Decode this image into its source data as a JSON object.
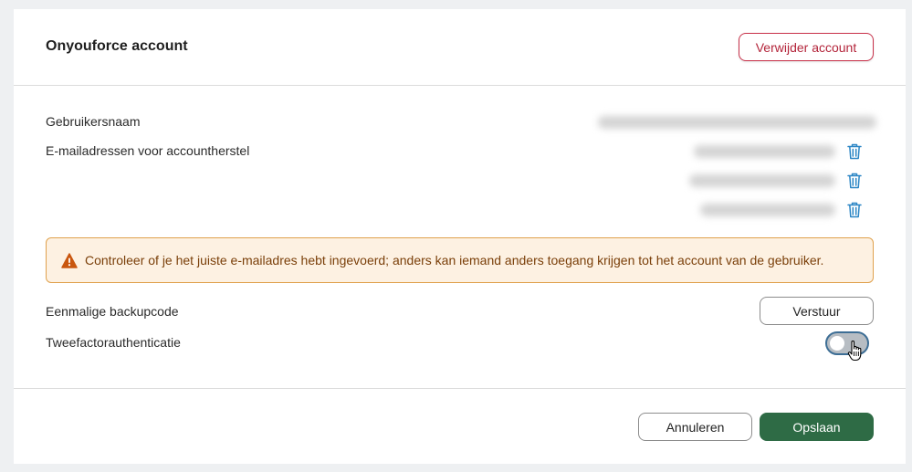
{
  "header": {
    "title": "Onyouforce account",
    "delete_label": "Verwijder account"
  },
  "fields": {
    "username_label": "Gebruikersnaam",
    "recovery_label": "E-mailadressen voor accountherstel",
    "backup_label": "Eenmalige backupcode",
    "twofactor_label": "Tweefactorauthenticatie"
  },
  "alert": {
    "text": "Controleer of je het juiste e-mailadres hebt ingevoerd; anders kan iemand anders toegang krijgen tot het account van de gebruiker."
  },
  "buttons": {
    "send_label": "Verstuur",
    "cancel_label": "Annuleren",
    "save_label": "Opslaan"
  },
  "toggle": {
    "twofactor_enabled": false
  },
  "icons": {
    "alert": "warning-icon",
    "trash": "trash-icon",
    "cursor": "hand-pointer-icon"
  },
  "colors": {
    "danger": "#c8314a",
    "primary": "#2e6b45",
    "warning_bg": "#fdf1e2",
    "warning_border": "#e0a24e",
    "warning_icon": "#c9560e",
    "link_icon": "#2b86c5"
  }
}
